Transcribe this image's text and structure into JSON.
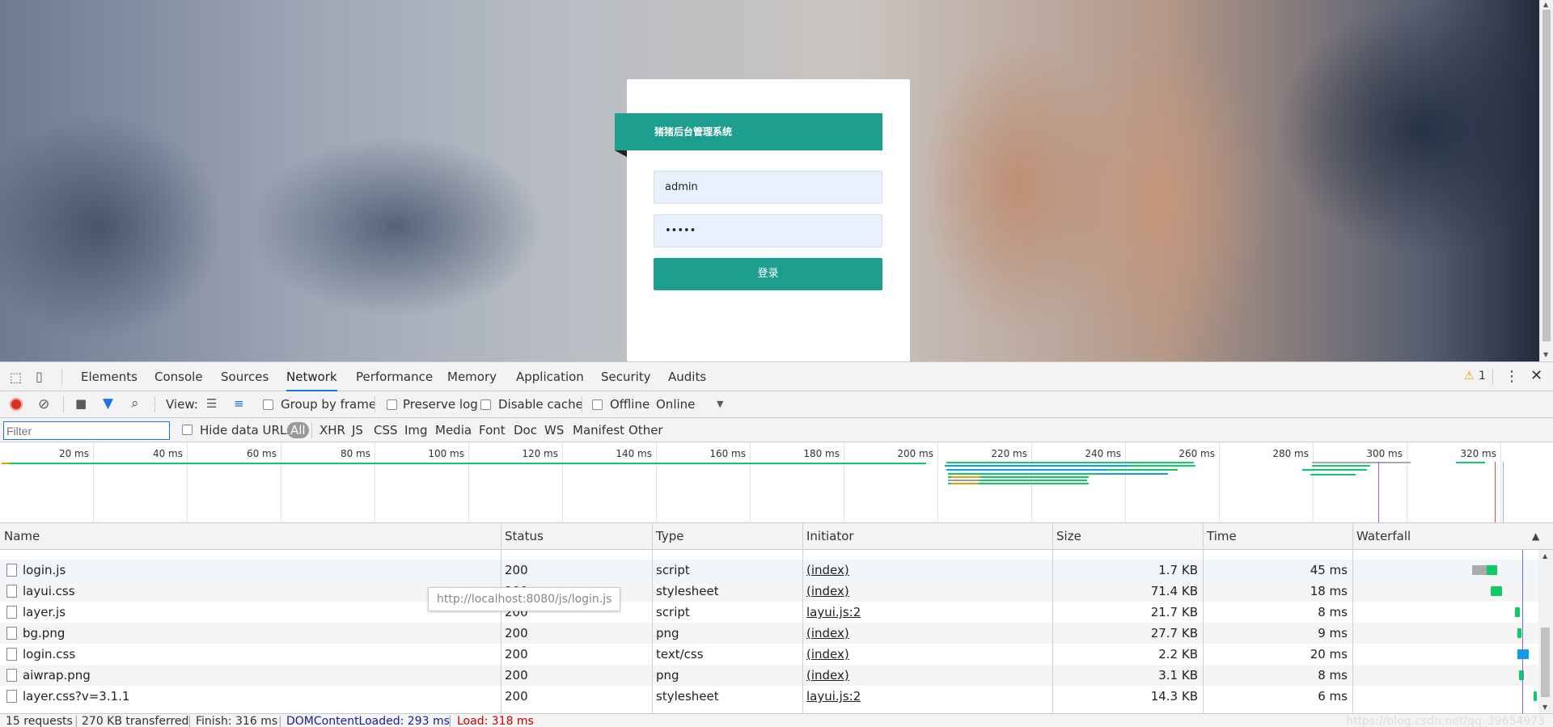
{
  "login": {
    "title": "猪猪后台管理系统",
    "username_value": "admin",
    "password_value": "•••••",
    "submit_label": "登录"
  },
  "devtools": {
    "tabs": [
      "Elements",
      "Console",
      "Sources",
      "Network",
      "Performance",
      "Memory",
      "Application",
      "Security",
      "Audits"
    ],
    "active_tab": "Network",
    "warning_count": "1",
    "toolbar": {
      "view_label": "View:",
      "group_by_frame": "Group by frame",
      "preserve_log": "Preserve log",
      "disable_cache": "Disable cache",
      "offline": "Offline",
      "throttle": "Online"
    },
    "filter": {
      "placeholder": "Filter",
      "hide_data_urls": "Hide data URLs",
      "types": [
        "All",
        "XHR",
        "JS",
        "CSS",
        "Img",
        "Media",
        "Font",
        "Doc",
        "WS",
        "Manifest",
        "Other"
      ]
    },
    "overview_ticks": [
      "20 ms",
      "40 ms",
      "60 ms",
      "80 ms",
      "100 ms",
      "120 ms",
      "140 ms",
      "160 ms",
      "180 ms",
      "200 ms",
      "220 ms",
      "240 ms",
      "260 ms",
      "280 ms",
      "300 ms",
      "320 ms"
    ],
    "columns": [
      "Name",
      "Status",
      "Type",
      "Initiator",
      "Size",
      "Time",
      "Waterfall"
    ],
    "rows": [
      {
        "name": "login.js",
        "status": "200",
        "type": "script",
        "initiator": "(index)",
        "size": "1.7 KB",
        "time": "45 ms"
      },
      {
        "name": "layui.css",
        "status": "200",
        "type": "stylesheet",
        "initiator": "(index)",
        "size": "71.4 KB",
        "time": "18 ms"
      },
      {
        "name": "layer.js",
        "status": "200",
        "type": "script",
        "initiator": "layui.js:2",
        "size": "21.7 KB",
        "time": "8 ms"
      },
      {
        "name": "bg.png",
        "status": "200",
        "type": "png",
        "initiator": "(index)",
        "size": "27.7 KB",
        "time": "9 ms"
      },
      {
        "name": "login.css",
        "status": "200",
        "type": "text/css",
        "initiator": "(index)",
        "size": "2.2 KB",
        "time": "20 ms"
      },
      {
        "name": "aiwrap.png",
        "status": "200",
        "type": "png",
        "initiator": "(index)",
        "size": "3.1 KB",
        "time": "8 ms"
      },
      {
        "name": "layer.css?v=3.1.1",
        "status": "200",
        "type": "stylesheet",
        "initiator": "layui.js:2",
        "size": "14.3 KB",
        "time": "6 ms"
      }
    ],
    "tooltip": "http://localhost:8080/js/login.js",
    "status": {
      "requests": "15 requests",
      "transferred": "270 KB transferred",
      "finish": "Finish: 316 ms",
      "dcl": "DOMContentLoaded: 293 ms",
      "load": "Load: 318 ms",
      "watermark": "https://blog.csdn.net/qq_39654973"
    },
    "colors": {
      "accent": "#1e9e8e",
      "dcl": "#1a1aa6",
      "load": "#c80000",
      "js_bar": "#0ccc63",
      "css_bar": "#0a9de8"
    }
  }
}
